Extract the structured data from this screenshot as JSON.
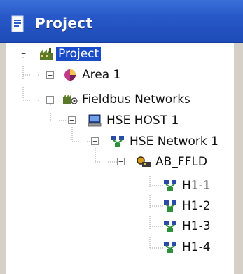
{
  "window": {
    "title": "Project",
    "title_icon": "project-document-icon"
  },
  "tree": {
    "nodes": [
      {
        "label": "Project",
        "icon": "project-factory-icon",
        "expander": "−",
        "selected": true
      },
      {
        "label": "Area 1",
        "icon": "area-pie-icon",
        "expander": "+"
      },
      {
        "label": "Fieldbus Networks",
        "icon": "fieldbus-networks-icon",
        "expander": "−"
      },
      {
        "label": "HSE HOST 1",
        "icon": "computer-host-icon",
        "expander": "−"
      },
      {
        "label": "HSE Network 1",
        "icon": "network-icon",
        "expander": "−"
      },
      {
        "label": "AB_FFLD",
        "icon": "linking-device-icon",
        "expander": "−"
      },
      {
        "label": "H1-1",
        "icon": "network-icon"
      },
      {
        "label": "H1-2",
        "icon": "network-icon"
      },
      {
        "label": "H1-3",
        "icon": "network-icon"
      },
      {
        "label": "H1-4",
        "icon": "network-icon"
      }
    ]
  },
  "colors": {
    "titlebar": "#2858c8",
    "selection": "#1b4cc8"
  }
}
